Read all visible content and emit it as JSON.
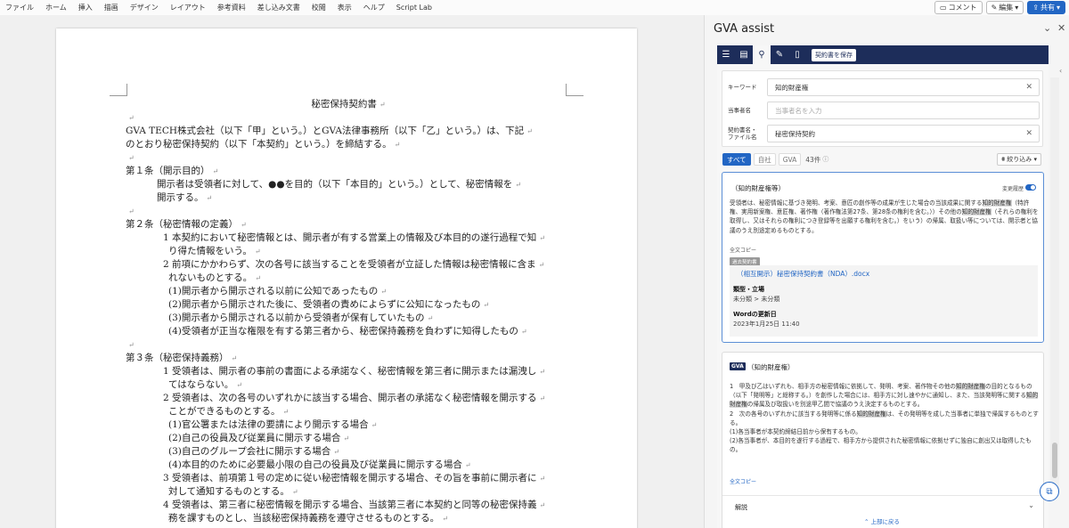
{
  "ribbon": {
    "tabs": [
      "ファイル",
      "ホーム",
      "挿入",
      "描画",
      "デザイン",
      "レイアウト",
      "参考資料",
      "差し込み文書",
      "校閲",
      "表示",
      "ヘルプ",
      "Script Lab"
    ],
    "comment_label": "コメント",
    "edit_label": "編集",
    "share_label": "共有"
  },
  "document": {
    "title": "秘密保持契約書",
    "lines": [
      {
        "text": "",
        "indent": 0
      },
      {
        "text": "GVA TECH株式会社（以下「甲」という。）とGVA法律事務所（以下「乙」という。）は、下記",
        "indent": 0
      },
      {
        "text": "のとおり秘密保持契約（以下「本契約」という。）を締結する。",
        "indent": 0
      },
      {
        "text": "",
        "indent": 0
      },
      {
        "text": "第１条（開示目的）",
        "indent": 0
      },
      {
        "text": "開示者は受領者に対して、●●を目的（以下「本目的」という。）として、秘密情報を",
        "indent": 1
      },
      {
        "text": "開示する。",
        "indent": 1
      },
      {
        "text": "",
        "indent": 0
      },
      {
        "text": "第２条（秘密情報の定義）",
        "indent": 0
      },
      {
        "text": "1 本契約において秘密情報とは、開示者が有する営業上の情報及び本目的の遂行過程で知",
        "indent": 2
      },
      {
        "text": "り得た情報をいう。",
        "indent": 3
      },
      {
        "text": "2 前項にかかわらず、次の各号に該当することを受領者が立証した情報は秘密情報に含ま",
        "indent": 2
      },
      {
        "text": "れないものとする。",
        "indent": 3
      },
      {
        "text": "(1)開示者から開示される以前に公知であったもの",
        "indent": 3
      },
      {
        "text": "(2)開示者から開示された後に、受領者の責めによらずに公知になったもの",
        "indent": 3
      },
      {
        "text": "(3)開示者から開示される以前から受領者が保有していたもの",
        "indent": 3
      },
      {
        "text": "(4)受領者が正当な権限を有する第三者から、秘密保持義務を負わずに知得したもの",
        "indent": 3
      },
      {
        "text": "",
        "indent": 0
      },
      {
        "text": "第３条（秘密保持義務）",
        "indent": 0
      },
      {
        "text": "1 受領者は、開示者の事前の書面による承諾なく、秘密情報を第三者に開示または漏洩し",
        "indent": 2
      },
      {
        "text": "てはならない。",
        "indent": 3
      },
      {
        "text": "2 受領者は、次の各号のいずれかに該当する場合、開示者の承諾なく秘密情報を開示する",
        "indent": 2
      },
      {
        "text": "ことができるものとする。",
        "indent": 3
      },
      {
        "text": "(1)官公署または法律の要請により開示する場合",
        "indent": 3
      },
      {
        "text": "(2)自己の役員及び従業員に開示する場合",
        "indent": 3
      },
      {
        "text": "(3)自己のグループ会社に開示する場合",
        "indent": 3
      },
      {
        "text": "(4)本目的のために必要最小限の自己の役員及び従業員に開示する場合",
        "indent": 3
      },
      {
        "text": "3 受領者は、前項第１号の定めに従い秘密情報を開示する場合、その旨を事前に開示者に",
        "indent": 2
      },
      {
        "text": "対して通知するものとする。",
        "indent": 3
      },
      {
        "text": "4 受領者は、第三者に秘密情報を開示する場合、当該第三者に本契約と同等の秘密保持義",
        "indent": 2
      },
      {
        "text": "務を課すものとし、当該秘密保持義務を遵守させるものとする。",
        "indent": 3
      }
    ]
  },
  "panel": {
    "title": "GVA assist",
    "toolbar": {
      "save_label": "契約書を保存"
    },
    "search": {
      "keyword_label": "キーワード",
      "keyword_value": "知的財産権",
      "party_label": "当事者名",
      "party_placeholder": "当事者名を入力",
      "contract_label_1": "契約書名・",
      "contract_label_2": "ファイル名",
      "contract_value": "秘密保持契約"
    },
    "filters": {
      "all": "すべて",
      "own": "自社",
      "gva": "GVA",
      "count": "43件",
      "narrow": "絞り込み"
    },
    "result1": {
      "tag": "（知的財産権等）",
      "toggle_label": "変更履歴",
      "p1_a": "受領者は、秘密情報に基づき発明、考案、意匠の創作等の成果が生じた場合の当該成果に関する",
      "p1_h1": "知的財産権",
      "p1_b": "（特許権、実用新案権、意匠権、著作権（著作権法第27条、第28条の権利を含む。））その他の",
      "p1_h2": "知的財産権",
      "p1_c": "（それらの権利を取得し、又はそれらの権利につき登録等を出願する権利を含む。）をいう）の帰属、取扱い等については、開示者と協議のうえ別途定めるものとする。",
      "copy": "全文コピー",
      "source_tag": "過去契約書",
      "source_link": "（相互開示）秘密保持契約書（NDA）.docx",
      "type_label": "類型・立場",
      "type_value": "未分類 > 未分類",
      "updated_label": "Wordの更新日",
      "updated_value": "2023年1月25日 11:40"
    },
    "result2": {
      "badge": "GVA",
      "tag": "（知的財産権）",
      "l1_a": "1　甲及び乙はいずれも、相手方の秘密情報に依拠して、発明、考案、著作物その他の",
      "l1_h": "知的財産権",
      "l1_b": "の目的となるもの（以下「発明等」と総称する。）を創作した場合には、相手方に対し速やかに通知し、また、当該発明等に関する",
      "l1_h2": "知的財産権",
      "l1_c": "の帰属及び取扱いを別途甲乙間で協議のうえ決定するものとする。",
      "l2_a": "2　次の各号のいずれかに該当する発明等に係る",
      "l2_h": "知的財産権",
      "l2_b": "は、その発明等を成した当事者に単独で帰属するものとする。",
      "l3": "(1)各当事者が本契約締結日前から保有するもの。",
      "l4": "(2)各当事者が、本目的を遂行する過程で、相手方から提供された秘密情報に依拠せずに独自に創出又は取得したもの。",
      "copy": "全文コピー",
      "explain": "解説"
    },
    "back_to_top": "上部に戻る"
  },
  "colors": {
    "navy": "#1d2d5a",
    "accent": "#2266c4"
  }
}
